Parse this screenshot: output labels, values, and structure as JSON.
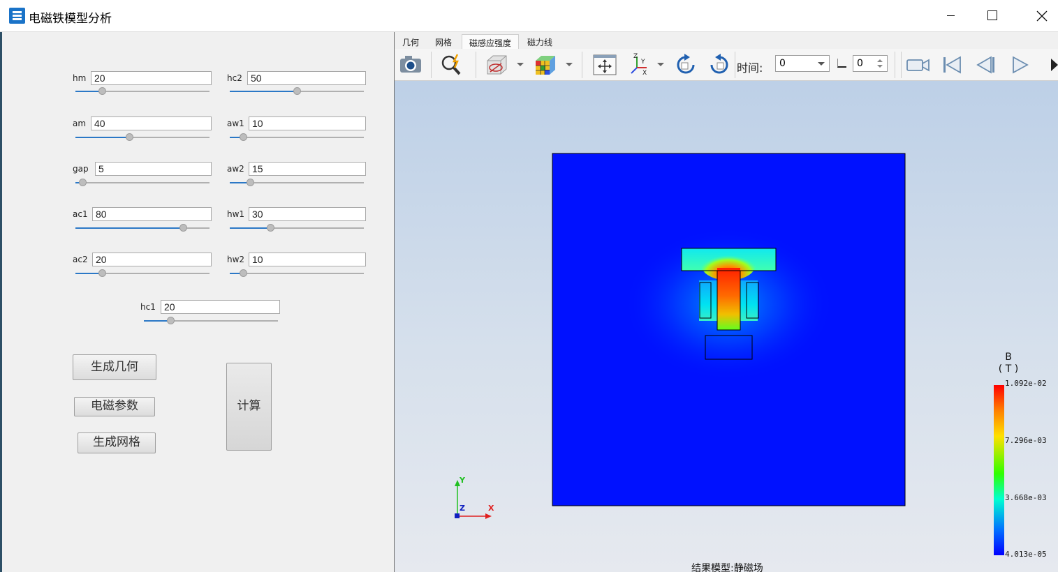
{
  "window": {
    "title": "电磁铁模型分析"
  },
  "params": {
    "hm": {
      "label": "hm",
      "value": "20",
      "level": 0.2
    },
    "am": {
      "label": "am",
      "value": "40",
      "level": 0.4
    },
    "gap": {
      "label": "gap",
      "value": "5",
      "level": 0.05
    },
    "ac1": {
      "label": "ac1",
      "value": "80",
      "level": 0.8
    },
    "ac2": {
      "label": "ac2",
      "value": "20",
      "level": 0.2
    },
    "hc2": {
      "label": "hc2",
      "value": "50",
      "level": 0.5
    },
    "aw1": {
      "label": "aw1",
      "value": "10",
      "level": 0.1
    },
    "aw2": {
      "label": "aw2",
      "value": "15",
      "level": 0.15
    },
    "hw1": {
      "label": "hw1",
      "value": "30",
      "level": 0.3
    },
    "hw2": {
      "label": "hw2",
      "value": "10",
      "level": 0.1
    },
    "hc1": {
      "label": "hc1",
      "value": "20",
      "level": 0.2
    }
  },
  "buttons": {
    "generate_geometry": "生成几何",
    "em_params": "电磁参数",
    "generate_mesh": "生成网格",
    "calculate": "计算"
  },
  "tabs": [
    "几何",
    "网格",
    "磁感应强度",
    "磁力线"
  ],
  "active_tab": 2,
  "toolbar": {
    "icons": [
      "camera-icon",
      "pick-icon",
      "clip-box-icon",
      "cube-display-icon",
      "fit-view-icon",
      "axes-orient-icon",
      "rotate-cw-icon",
      "rotate-ccw-icon",
      "video-icon",
      "first-frame-icon",
      "prev-frame-icon",
      "next-frame-icon"
    ],
    "time_label": "时间:",
    "time_value": "0",
    "step_value": "0"
  },
  "viewport": {
    "result_label": "结果模型:静磁场",
    "axes": {
      "x": "X",
      "y": "Y",
      "z": "Z"
    }
  },
  "colorbar": {
    "title_line1": "B",
    "title_line2": "( T )",
    "ticks": [
      "1.092e-02",
      "7.296e-03",
      "3.668e-03",
      "4.013e-05"
    ],
    "colors": {
      "max": "#ff0000",
      "min": "#0000ff"
    }
  },
  "colors": {
    "accent": "#2b78c6",
    "field_background": "#0011ff"
  }
}
